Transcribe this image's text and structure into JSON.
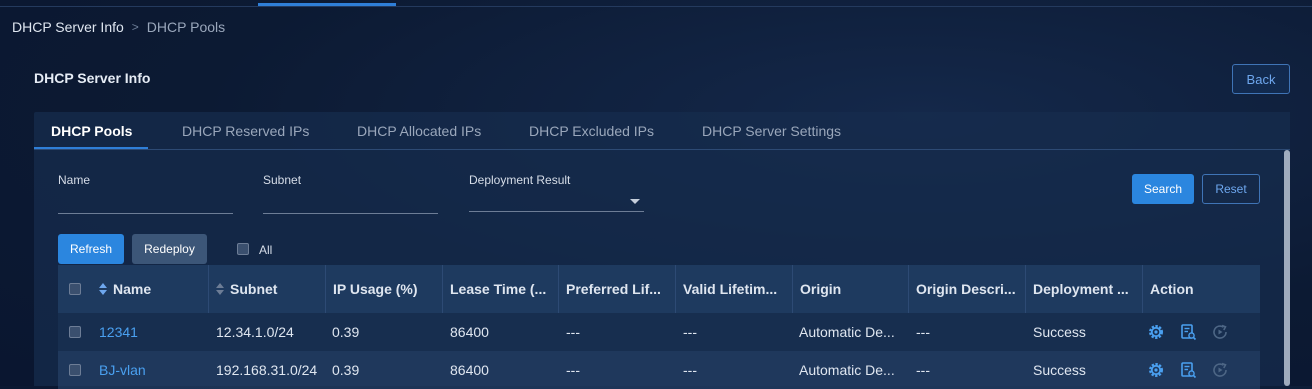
{
  "breadcrumb": {
    "parent": "DHCP Server Info",
    "separator": ">",
    "current": "DHCP Pools"
  },
  "page": {
    "title": "DHCP Server Info",
    "back_label": "Back"
  },
  "tabs": [
    {
      "label": "DHCP Pools",
      "active": true
    },
    {
      "label": "DHCP Reserved IPs",
      "active": false
    },
    {
      "label": "DHCP Allocated IPs",
      "active": false
    },
    {
      "label": "DHCP Excluded IPs",
      "active": false
    },
    {
      "label": "DHCP Server Settings",
      "active": false
    }
  ],
  "filters": {
    "name_label": "Name",
    "name_value": "",
    "subnet_label": "Subnet",
    "subnet_value": "",
    "deployment_label": "Deployment Result",
    "deployment_value": "",
    "search_label": "Search",
    "reset_label": "Reset"
  },
  "toolbar": {
    "refresh_label": "Refresh",
    "redeploy_label": "Redeploy",
    "all_label": "All"
  },
  "table": {
    "columns": [
      "Name",
      "Subnet",
      "IP Usage (%)",
      "Lease Time (...",
      "Preferred Lif...",
      "Valid Lifetim...",
      "Origin",
      "Origin Descri...",
      "Deployment ...",
      "Action"
    ],
    "rows": [
      [
        "12341",
        "12.34.1.0/24",
        "0.39",
        "86400",
        "---",
        "---",
        "Automatic De...",
        "---",
        "Success"
      ],
      [
        "BJ-vlan",
        "192.168.31.0/24",
        "0.39",
        "86400",
        "---",
        "---",
        "Automatic De...",
        "---",
        "Success"
      ]
    ]
  },
  "icons": {
    "sort": "sort-icon",
    "settings": "gear-icon",
    "view": "view-details-icon",
    "deploy": "redeploy-icon"
  },
  "colors": {
    "accent": "#2b86df",
    "link": "#4aa0f0",
    "background": "#0c1a33",
    "disabled_icon": "#4d6685"
  }
}
